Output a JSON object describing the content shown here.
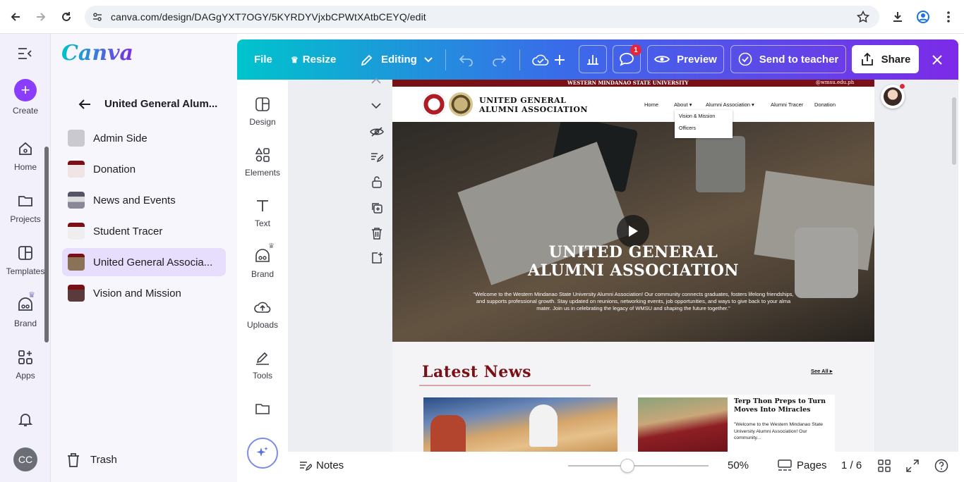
{
  "browser": {
    "url": "canva.com/design/DAGgYXT7OGY/5KYRDYVjxbCPWtXAtbCEYQ/edit"
  },
  "rail": {
    "create": "Create",
    "home": "Home",
    "projects": "Projects",
    "templates": "Templates",
    "brand": "Brand",
    "apps": "Apps",
    "avatar_initials": "CC"
  },
  "projects_panel": {
    "logo": "Canva",
    "folder_title": "United General Alum...",
    "items": [
      {
        "label": "Admin Side"
      },
      {
        "label": "Donation"
      },
      {
        "label": "News and Events"
      },
      {
        "label": "Student Tracer"
      },
      {
        "label": "United General Associa..."
      },
      {
        "label": "Vision and Mission"
      }
    ],
    "trash": "Trash"
  },
  "toolbar": {
    "file": "File",
    "resize": "Resize",
    "editing": "Editing",
    "comment_badge": "1",
    "preview": "Preview",
    "send": "Send to teacher",
    "share": "Share"
  },
  "side_panel": {
    "design": "Design",
    "elements": "Elements",
    "text": "Text",
    "brand": "Brand",
    "uploads": "Uploads",
    "tools": "Tools"
  },
  "bottom": {
    "notes": "Notes",
    "zoom": "50%",
    "zoom_fraction": 0.42,
    "pages": "Pages",
    "page_count": "1 / 6"
  },
  "site": {
    "top_strip_left": "WESTERN MINDANAO STATE UNIVERSITY",
    "top_strip_right": "@wmsu.edu.ph",
    "brand_line1": "UNITED GENERAL",
    "brand_line2": "ALUMNI ASSOCIATION",
    "nav": [
      "Home",
      "About",
      "Alumni Association",
      "Alumni Tracer",
      "Donation"
    ],
    "dropdown": [
      "Vision & Mission",
      "Officers"
    ],
    "hero_line1": "UNITED GENERAL",
    "hero_line2": "ALUMNI ASSOCIATION",
    "hero_text": "\"Welcome to the Western Mindanao State University Alumni Association! Our community connects graduates, fosters lifelong friendships, and supports professional growth. Stay updated on reunions, networking events, job opportunities, and ways to give back to your alma mater. Join us in celebrating the legacy of WMSU and shaping the future together.\"",
    "news_heading": "Latest News",
    "see_all": "See All",
    "news_card_title": "Terp Thon Preps to Turn Moves Into Miracles",
    "news_card_text": "\"Welcome to the Western Mindanao State University Alumni Association! Our community..."
  },
  "colors": {
    "accent": "#8b3dff",
    "maroon": "#7a0f16"
  }
}
